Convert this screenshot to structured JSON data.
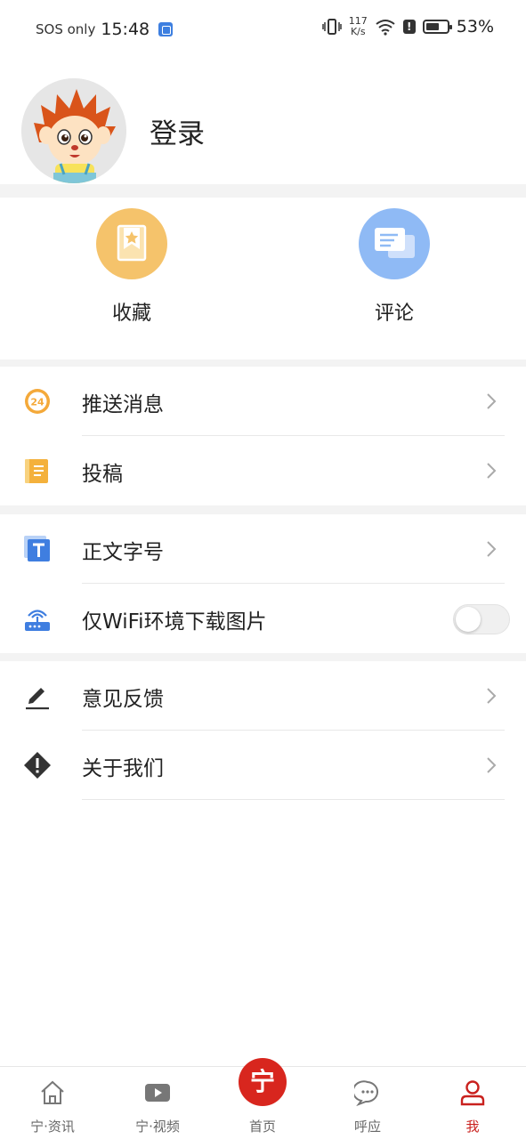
{
  "status_bar": {
    "carrier": "SOS only",
    "time": "15:48",
    "net_speed_value": "117",
    "net_speed_unit": "K/s",
    "battery": "53%"
  },
  "profile": {
    "login_label": "登录"
  },
  "quick_actions": [
    {
      "label": "收藏",
      "icon": "bookmark-icon",
      "color": "#f5c36b"
    },
    {
      "label": "评论",
      "icon": "comment-icon",
      "color": "#8fbaf5"
    }
  ],
  "menu": {
    "push": {
      "label": "推送消息",
      "icon": "24h-clock-icon"
    },
    "submit": {
      "label": "投稿",
      "icon": "notebook-icon"
    },
    "font_size": {
      "label": "正文字号",
      "icon": "text-size-icon"
    },
    "wifi_only": {
      "label": "仅WiFi环境下载图片",
      "icon": "wifi-router-icon",
      "toggle_on": false
    },
    "feedback": {
      "label": "意见反馈",
      "icon": "pencil-icon"
    },
    "about": {
      "label": "关于我们",
      "icon": "info-diamond-icon"
    }
  },
  "bottom_nav": [
    {
      "label": "宁·资讯",
      "icon": "home-icon"
    },
    {
      "label": "宁·视频",
      "icon": "video-play-icon"
    },
    {
      "label": "首页",
      "icon": "ning-logo-icon",
      "glyph": "宁"
    },
    {
      "label": "呼应",
      "icon": "chat-bubble-icon"
    },
    {
      "label": "我",
      "icon": "person-icon",
      "active": true
    }
  ],
  "colors": {
    "accent": "#c9211e",
    "bookmark": "#f5c36b",
    "comment": "#8fbaf5",
    "text": "#222222",
    "band": "#f3f3f3"
  }
}
